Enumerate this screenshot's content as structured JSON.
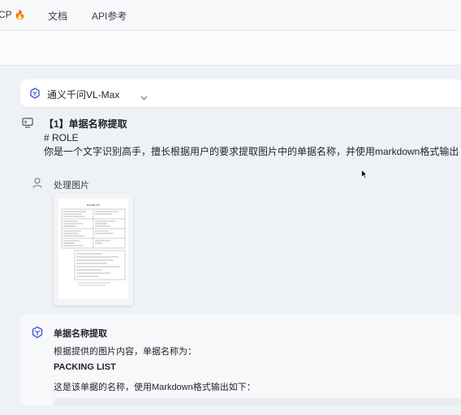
{
  "nav": {
    "first_label": "CP",
    "first_icon": "fire-icon",
    "docs_label": "文档",
    "api_label": "API参考"
  },
  "model": {
    "name": "通义千问VL-Max",
    "icon": "model-logo-icon"
  },
  "system_prompt": {
    "title": "【1】单据名称提取",
    "line2": "# ROLE",
    "line3": "你是一个文字识别高手，擅长根据用户的要求提取图片中的单据名称，并使用markdown格式输出"
  },
  "user_message": {
    "label": "处理图片",
    "image_title": "PACKING LIST"
  },
  "assistant": {
    "title": "单据名称提取",
    "line1": "根据提供的图片内容，单据名称为：",
    "packing": "PACKING LIST",
    "line2": "这是该单据的名称，使用Markdown格式输出如下："
  },
  "colors": {
    "background": "#eef1f6",
    "accent": "#4b5bd6",
    "fire": "#ff7a1a"
  }
}
